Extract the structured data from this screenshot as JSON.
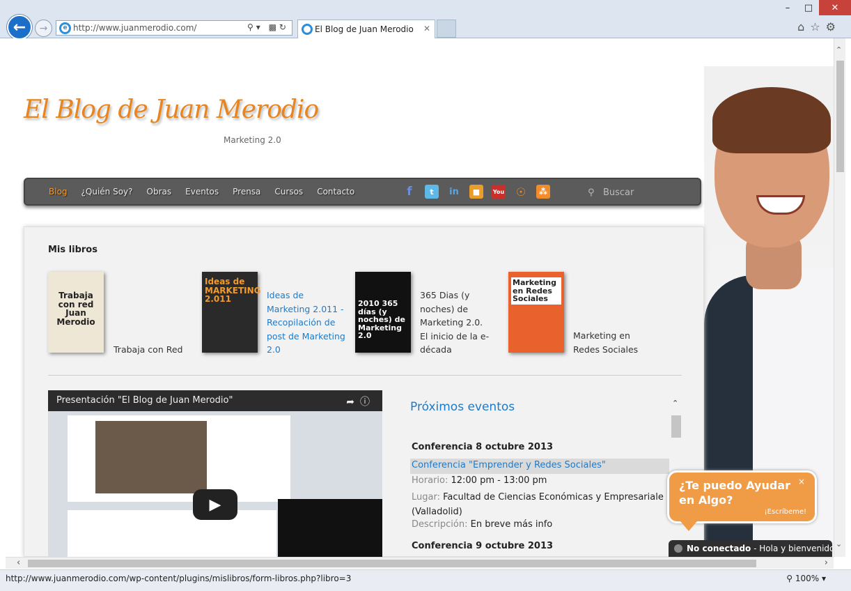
{
  "browser": {
    "address_url": "http://www.juanmerodio.com/",
    "tab_title": "El Blog de Juan Merodio",
    "status_url": "http://www.juanmerodio.com/wp-content/plugins/mislibros/form-libros.php?libro=3",
    "zoom": "100%"
  },
  "site": {
    "logo_text": "El Blog de Juan Merodio",
    "tagline": "Marketing 2.0"
  },
  "nav": {
    "items": [
      "Blog",
      "¿Quién Soy?",
      "Obras",
      "Eventos",
      "Prensa",
      "Cursos",
      "Contacto"
    ],
    "search_placeholder": "Buscar",
    "social_icons": [
      "facebook-icon",
      "twitter-icon",
      "linkedin-icon",
      "stumbleupon-icon",
      "youtube-icon",
      "podcast-icon",
      "rss-icon"
    ]
  },
  "books": {
    "heading": "Mis libros",
    "items": [
      {
        "title": "Trabaja con Red",
        "cover_text": "Trabaja con red\nJuan Merodio"
      },
      {
        "title": "Ideas de Marketing 2.011 - Recopilación de post de Marketing 2.0",
        "cover_text": "Ideas de MARKETING 2.011"
      },
      {
        "title": "365 Dias (y noches) de Marketing 2.0. El inicio de la e-década",
        "cover_text": "2010 365 días (y noches) de Marketing 2.0"
      },
      {
        "title": "Marketing en Redes Sociales",
        "cover_text": "Marketing en Redes Sociales"
      }
    ]
  },
  "video": {
    "title": "Presentación \"El Blog de Juan Merodio\""
  },
  "events": {
    "heading": "Próximos eventos",
    "date1": "Conferencia 8 octubre 2013",
    "title1": "Conferencia \"Emprender y Redes Sociales\"",
    "horario_label": "Horario:",
    "horario": "12:00 pm - 13:00 pm",
    "lugar_label": "Lugar:",
    "lugar": "Facultad de Ciencias Económicas y Empresariale (Valladolid)",
    "desc_label": "Descripción:",
    "desc": "En breve más info",
    "date2": "Conferencia 9 octubre 2013"
  },
  "chat": {
    "bubble": "¿Te puedo Ayudar en Algo?",
    "write": "¡Escríbeme!",
    "close": "×",
    "status_label": "No conectado",
    "status_text": " - Hola y bienvenido a"
  },
  "colors": {
    "accent": "#e8851e",
    "link": "#1e7ac8",
    "nav_bg": "#5b5b5b"
  }
}
